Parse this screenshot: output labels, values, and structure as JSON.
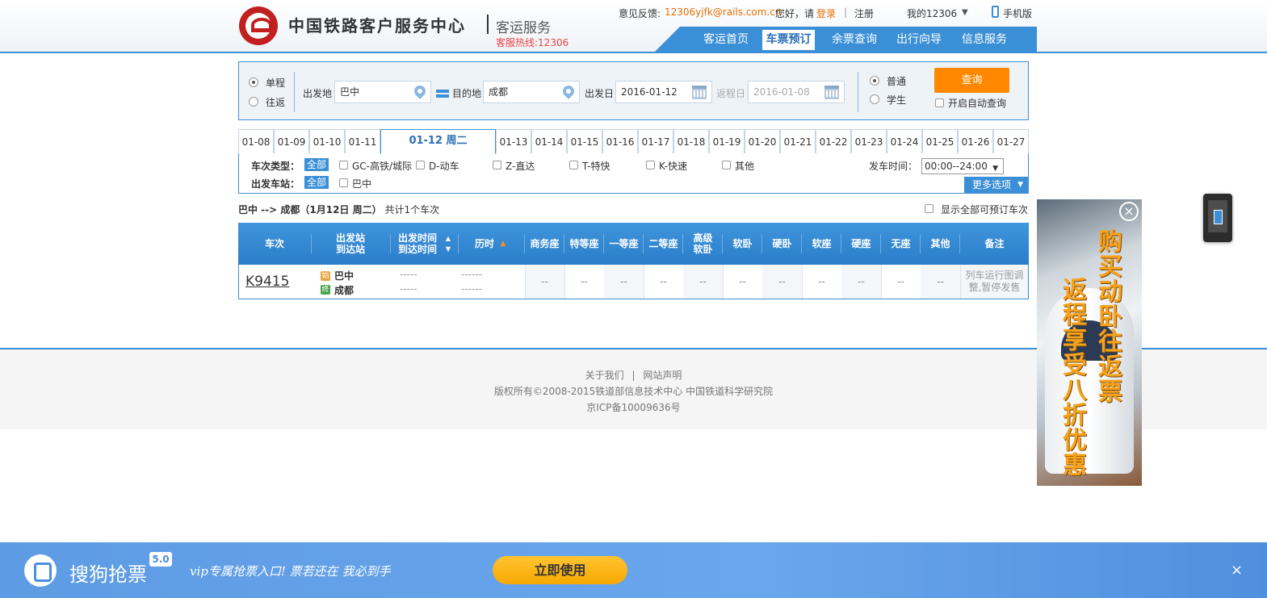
{
  "header": {
    "site_title": "中国铁路客户服务中心",
    "site_sub": "客运服务",
    "hotline": "客服热线:12306",
    "feedback_label": "意见反馈:",
    "feedback_email": "12306yjfk@rails.com.cn",
    "hello": "您好，请",
    "login": "登录",
    "sep": "|",
    "register": "注册",
    "my12306": "我的12306",
    "mobile": "手机版",
    "nav": [
      "客运首页",
      "车票预订",
      "余票查询",
      "出行向导",
      "信息服务"
    ],
    "nav_active": 1
  },
  "search": {
    "trip_one_way": "单程",
    "trip_round": "往返",
    "from_label": "出发地",
    "from_value": "巴中",
    "to_label": "目的地",
    "to_value": "成都",
    "depart_label": "出发日",
    "depart_value": "2016-01-12",
    "return_label": "返程日",
    "return_value": "2016-01-08",
    "ticket_normal": "普通",
    "ticket_student": "学生",
    "query_button": "查询",
    "auto_query": "开启自动查询"
  },
  "dates": [
    "01-08",
    "01-09",
    "01-10",
    "01-11",
    "01-12 周二",
    "01-13",
    "01-14",
    "01-15",
    "01-16",
    "01-17",
    "01-18",
    "01-19",
    "01-20",
    "01-21",
    "01-22",
    "01-23",
    "01-24",
    "01-25",
    "01-26",
    "01-27"
  ],
  "filters": {
    "type_label": "车次类型：",
    "all": "全部",
    "types": [
      "GC-高铁/城际",
      "D-动车",
      "Z-直达",
      "T-特快",
      "K-快速",
      "其他"
    ],
    "station_label": "出发车站：",
    "stations": [
      "巴中"
    ],
    "time_label": "发车时间：",
    "time_value": "00:00--24:00",
    "more": "更多选项"
  },
  "summary": {
    "route": "巴中 --> 成都（1月12日  周二）",
    "count_text": "共计1个车次",
    "show_all": "显示全部可预订车次"
  },
  "table": {
    "headers": [
      "车次",
      "出发站\n到达站",
      "出发时间\n到达时间",
      "历时",
      "商务座",
      "特等座",
      "一等座",
      "二等座",
      "高级\n软卧",
      "软卧",
      "硬卧",
      "软座",
      "硬座",
      "无座",
      "其他",
      "备注"
    ],
    "row": {
      "train_no": "K9415",
      "from_tag": "始",
      "from": "巴中",
      "to_tag": "终",
      "to": "成都",
      "depart": "-----",
      "arrive": "-----",
      "duration1": "------",
      "duration2": "------",
      "seats": [
        "--",
        "--",
        "--",
        "--",
        "--",
        "--",
        "--",
        "--",
        "--",
        "--",
        "--"
      ],
      "note": "列车运行图调整,暂停发售"
    }
  },
  "footer": {
    "about": "关于我们",
    "sep": "|",
    "statement": "网站声明",
    "copyright": "版权所有©2008-2015铁道部信息技术中心   中国铁道科学研究院",
    "icp": "京ICP备10009636号"
  },
  "ad": {
    "line1": "购买动卧往返票",
    "line2": "返程享受八折优惠",
    "close": "×"
  },
  "bottom_bar": {
    "name": "搜狗抢票",
    "version": "5.0",
    "slogan": "vip专属抢票入口!   票若还在 我必到手",
    "button": "立即使用",
    "close": "×"
  }
}
